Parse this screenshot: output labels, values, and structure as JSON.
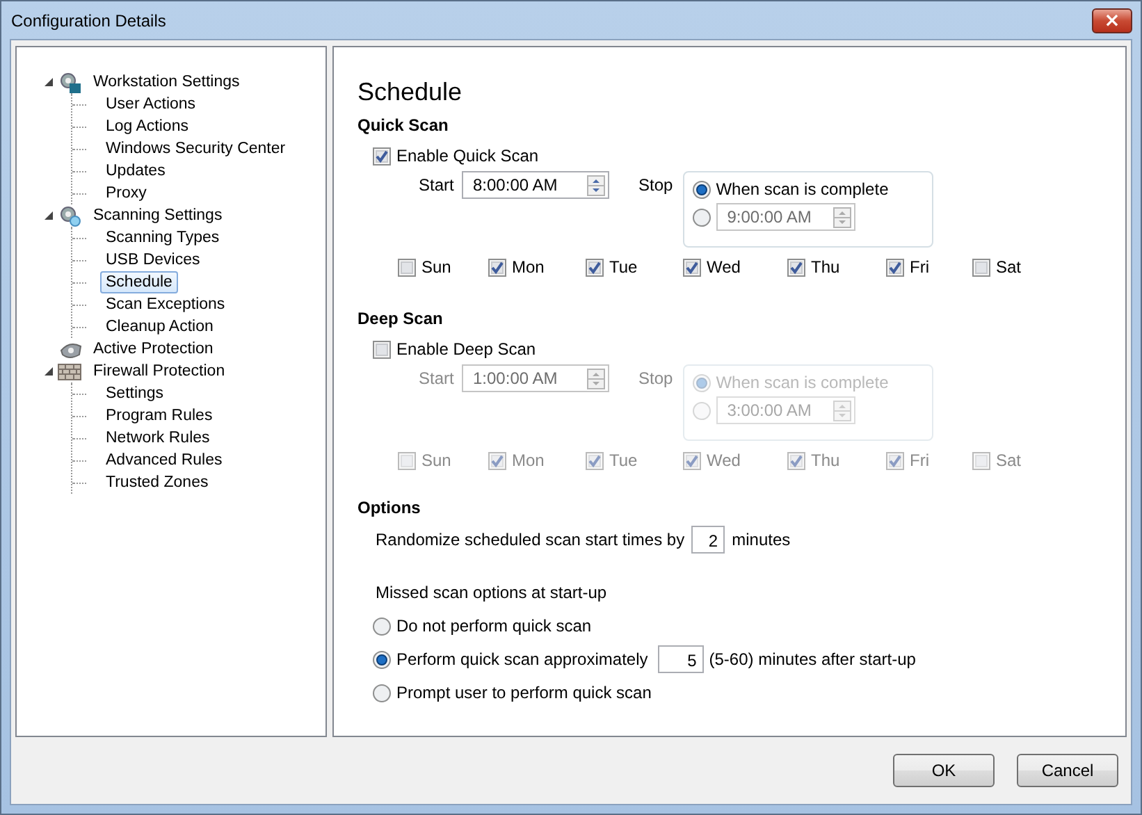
{
  "window": {
    "title": "Configuration Details",
    "close": "×"
  },
  "tree": [
    {
      "label": "Workstation Settings",
      "expanded": true,
      "children": [
        {
          "label": "User Actions",
          "selected": false
        },
        {
          "label": "Log Actions",
          "selected": false
        },
        {
          "label": "Windows Security Center",
          "selected": false
        },
        {
          "label": "Updates",
          "selected": false
        },
        {
          "label": "Proxy",
          "selected": false
        }
      ]
    },
    {
      "label": "Scanning Settings",
      "expanded": true,
      "children": [
        {
          "label": "Scanning Types",
          "selected": false
        },
        {
          "label": "USB Devices",
          "selected": false
        },
        {
          "label": "Schedule",
          "selected": true
        },
        {
          "label": "Scan Exceptions",
          "selected": false
        },
        {
          "label": "Cleanup Action",
          "selected": false
        }
      ]
    },
    {
      "label": "Active Protection"
    },
    {
      "label": "Firewall Protection",
      "expanded": true,
      "children": [
        {
          "label": "Settings",
          "selected": false
        },
        {
          "label": "Program Rules",
          "selected": false
        },
        {
          "label": "Network Rules",
          "selected": false
        },
        {
          "label": "Advanced Rules",
          "selected": false
        },
        {
          "label": "Trusted Zones",
          "selected": false
        }
      ]
    }
  ],
  "page_title": "Schedule",
  "scans": [
    {
      "heading": "Quick Scan",
      "enable": {
        "label": "Enable Quick Scan",
        "checked": true
      },
      "disabled": false,
      "start_label": "Start",
      "start_value": "8:00:00 AM",
      "stop_label": "Stop",
      "stop_options": [
        {
          "kind": "text",
          "label": "When scan is complete",
          "selected": true
        },
        {
          "kind": "time",
          "value": "9:00:00 AM",
          "selected": false
        }
      ],
      "days": [
        {
          "label": "Sun",
          "checked": false
        },
        {
          "label": "Mon",
          "checked": true
        },
        {
          "label": "Tue",
          "checked": true
        },
        {
          "label": "Wed",
          "checked": true
        },
        {
          "label": "Thu",
          "checked": true
        },
        {
          "label": "Fri",
          "checked": true
        },
        {
          "label": "Sat",
          "checked": false
        }
      ]
    },
    {
      "heading": "Deep Scan",
      "enable": {
        "label": "Enable Deep Scan",
        "checked": false
      },
      "disabled": true,
      "start_label": "Start",
      "start_value": "1:00:00 AM",
      "stop_label": "Stop",
      "stop_options": [
        {
          "kind": "text",
          "label": "When scan is complete",
          "selected": true
        },
        {
          "kind": "time",
          "value": "3:00:00 AM",
          "selected": false
        }
      ],
      "days": [
        {
          "label": "Sun",
          "checked": false
        },
        {
          "label": "Mon",
          "checked": true
        },
        {
          "label": "Tue",
          "checked": true
        },
        {
          "label": "Wed",
          "checked": true
        },
        {
          "label": "Thu",
          "checked": true
        },
        {
          "label": "Fri",
          "checked": true
        },
        {
          "label": "Sat",
          "checked": false
        }
      ]
    }
  ],
  "options": {
    "heading": "Options",
    "randomize": {
      "label": "Randomize scheduled scan start times by",
      "value": "2",
      "unit": "minutes"
    },
    "missed": {
      "label": "Missed scan options at start-up",
      "choices": [
        {
          "kind": "text",
          "label": "Do not perform quick scan",
          "selected": false
        },
        {
          "kind": "input",
          "label": "Perform quick scan approximately",
          "value": "5",
          "suffix": "(5-60) minutes after start-up",
          "selected": true
        },
        {
          "kind": "text",
          "label": "Prompt user to perform quick scan",
          "selected": false
        }
      ]
    }
  },
  "buttons": [
    "OK",
    "Cancel"
  ]
}
